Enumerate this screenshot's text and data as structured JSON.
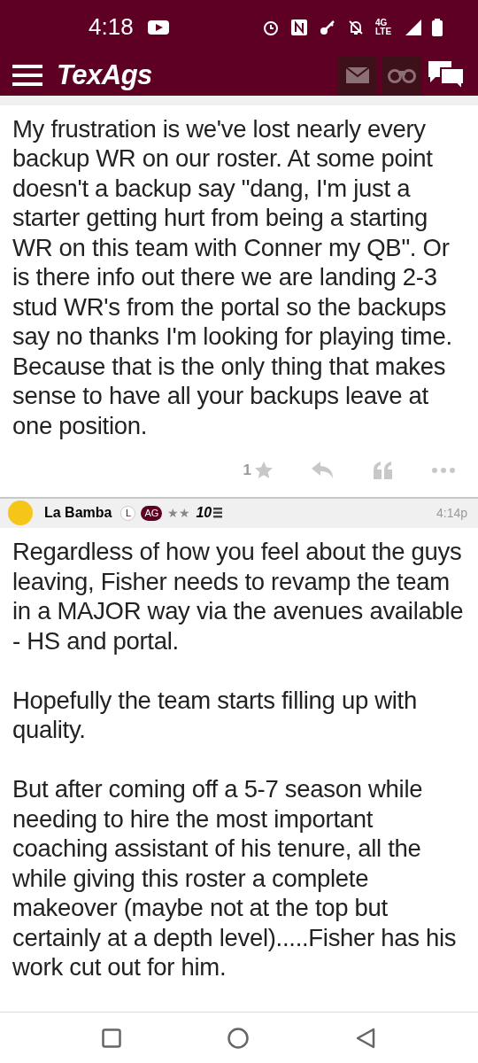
{
  "status_bar": {
    "time": "4:18",
    "network": "4G LTE"
  },
  "app_bar": {
    "logo": "TexAgs"
  },
  "posts": [
    {
      "cut_off": true,
      "paragraphs": [
        "My frustration is we've lost nearly every backup WR on our roster. At some point doesn't a backup say \"dang, I'm just a starter getting hurt from being a starting WR on this team with Conner my QB\". Or is there info out there we are landing 2-3 stud WR's from the portal so the backups say no thanks I'm looking for playing time. Because that is the only thing that makes sense to have all your backups leave at one position."
      ],
      "star_count": "1"
    },
    {
      "cut_off": false,
      "author": "La Bamba",
      "badges": [
        "L",
        "AG"
      ],
      "rank": "★★",
      "level": "10",
      "time": "4:14p",
      "paragraphs": [
        "Regardless of how you feel about the guys leaving, Fisher needs to revamp the team in a MAJOR way via the avenues available - HS and portal.",
        "Hopefully the team starts filling up with quality.",
        "But after coming off a 5-7 season while needing to hire the most important coaching assistant of his tenure, all the while giving this roster a complete makeover (maybe not at the top but certainly at a depth level).....Fisher has his work cut out for him."
      ]
    }
  ]
}
